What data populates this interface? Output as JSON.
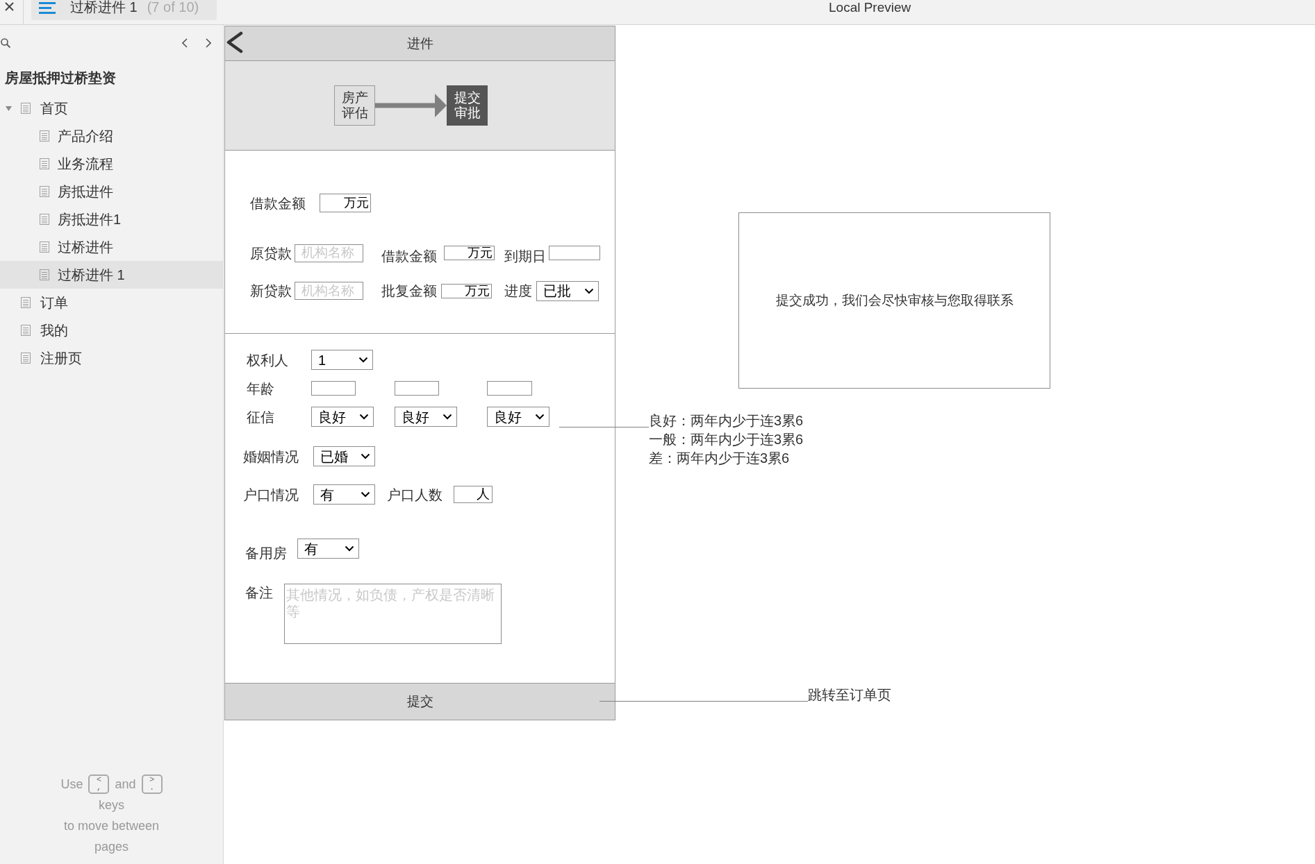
{
  "top_bar": {
    "tab": {
      "title": "过桥进件 1",
      "counter": "(7 of 10)"
    },
    "preview_title": "Local Preview"
  },
  "sidebar": {
    "project_title": "房屋抵押过桥垫资",
    "pages": [
      {
        "label": "首页",
        "selected": false,
        "expanded": true,
        "children": [
          {
            "label": "产品介绍",
            "selected": false
          },
          {
            "label": "业务流程",
            "selected": false
          },
          {
            "label": "房抵进件",
            "selected": false
          },
          {
            "label": "房抵进件1",
            "selected": false
          },
          {
            "label": "过桥进件",
            "selected": false
          },
          {
            "label": "过桥进件 1",
            "selected": true
          }
        ]
      },
      {
        "label": "订单",
        "selected": false
      },
      {
        "label": "我的",
        "selected": false
      },
      {
        "label": "注册页",
        "selected": false
      }
    ],
    "hint": {
      "before": "Use",
      "keys": [
        {
          "top": "<",
          "bottom": ","
        },
        {
          "top": ">",
          "bottom": "."
        }
      ],
      "between": "and",
      "after": "keys",
      "last": "to move between pages"
    }
  },
  "phone": {
    "header": {
      "title": "进件"
    },
    "steps": [
      {
        "label": "房产评估",
        "current": false
      },
      {
        "label": "提交审批",
        "current": true
      }
    ],
    "loan": {
      "amount": {
        "label": "借款金额",
        "unit": "万元"
      },
      "original_loan": {
        "label": "原贷款",
        "placeholder": "机构名称",
        "amount_label": "借款金额",
        "amount_unit": "万元",
        "due_label": "到期日"
      },
      "new_loan": {
        "label": "新贷款",
        "placeholder": "机构名称",
        "amount_label": "批复金额",
        "amount_unit": "万元",
        "progress_label": "进度",
        "progress_value": "已批"
      }
    },
    "owner": {
      "holder": {
        "label": "权利人",
        "value": "1"
      },
      "age_label": "年龄",
      "credit_label": "征信",
      "persons": [
        {
          "credit": "良好"
        },
        {
          "credit": "良好"
        },
        {
          "credit": "良好"
        }
      ],
      "marital": {
        "label": "婚姻情况",
        "value": "已婚"
      },
      "hukou": {
        "label": "户口情况",
        "value": "有",
        "count_label": "户口人数",
        "count_unit": "人"
      },
      "spare_house": {
        "label": "备用房",
        "value": "有"
      },
      "remarks": {
        "label": "备注",
        "placeholder": "其他情况，如负债，产权是否清晰等"
      }
    },
    "submit": {
      "label": "提交"
    }
  },
  "success_dialog": {
    "message": "提交成功，我们会尽快审核与您取得联系"
  },
  "annotations": {
    "credit_notes": [
      "良好：两年内少于连3累6",
      "一般：两年内少于连3累6",
      "差：两年内少于连3累6"
    ],
    "submit_note": "跳转至订单页"
  }
}
